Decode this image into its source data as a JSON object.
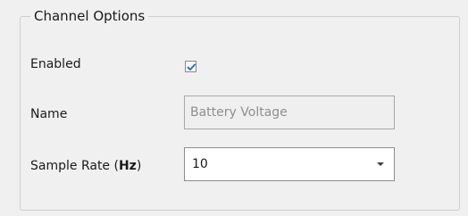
{
  "group": {
    "title": "Channel Options"
  },
  "enabled": {
    "label": "Enabled",
    "checked": true
  },
  "name": {
    "label": "Name",
    "value": "Battery Voltage"
  },
  "sample_rate": {
    "label_prefix": "Sample Rate (",
    "label_unit": "Hz",
    "label_suffix": ")",
    "value": "10"
  },
  "colors": {
    "checkmark": "#2b6fd6",
    "disabled_text": "#8f8f8f"
  },
  "icons": {
    "checkbox": "checkmark-icon",
    "dropdown": "chevron-down-icon"
  }
}
